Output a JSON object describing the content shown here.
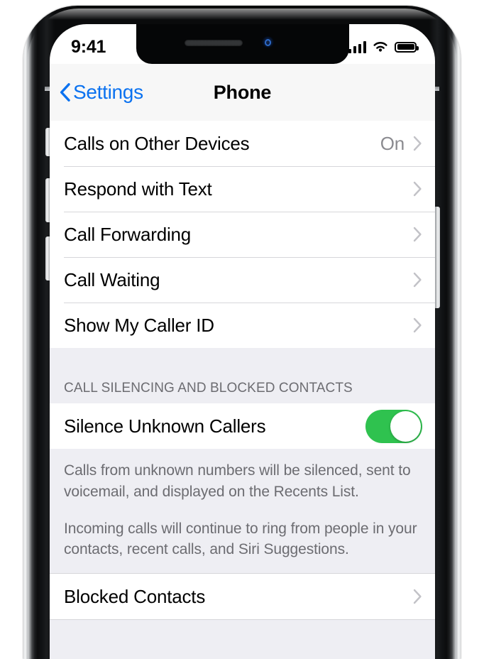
{
  "status_bar": {
    "time": "9:41",
    "signal_icon": "cellular-signal-icon",
    "signal_bars_filled": 4,
    "wifi_icon": "wifi-icon",
    "battery_icon": "battery-full-icon"
  },
  "nav": {
    "back_label": "Settings",
    "back_icon": "chevron-left-icon",
    "title": "Phone"
  },
  "groups": [
    {
      "rows": [
        {
          "label": "Calls on Other Devices",
          "value": "On",
          "accessory": "chevron-right-icon"
        },
        {
          "label": "Respond with Text",
          "value": "",
          "accessory": "chevron-right-icon"
        },
        {
          "label": "Call Forwarding",
          "value": "",
          "accessory": "chevron-right-icon"
        },
        {
          "label": "Call Waiting",
          "value": "",
          "accessory": "chevron-right-icon"
        },
        {
          "label": "Show My Caller ID",
          "value": "",
          "accessory": "chevron-right-icon"
        }
      ]
    }
  ],
  "silencing_section": {
    "header": "CALL SILENCING AND BLOCKED CONTACTS",
    "toggle_row": {
      "label": "Silence Unknown Callers",
      "toggle_on": true,
      "toggle_color": "#2FC24F"
    },
    "footer_paragraph_1": "Calls from unknown numbers will be silenced, sent to voicemail, and displayed on the Recents List.",
    "footer_paragraph_2": "Incoming calls will continue to ring from people in your contacts, recent calls, and Siri Suggestions."
  },
  "blocked_section": {
    "row": {
      "label": "Blocked Contacts",
      "accessory": "chevron-right-icon"
    }
  },
  "colors": {
    "tint_blue": "#0B72F0",
    "toggle_green": "#2FC24F",
    "group_background": "#EEEEF3",
    "secondary_text": "#6C6C71",
    "value_text": "#8B8B90"
  },
  "hardware": {
    "mute_switch": "mute-switch",
    "volume_up": "volume-up-button",
    "volume_down": "volume-down-button",
    "side_button": "side-power-button",
    "notch_speaker": "earpiece-speaker",
    "front_camera": "front-camera"
  }
}
